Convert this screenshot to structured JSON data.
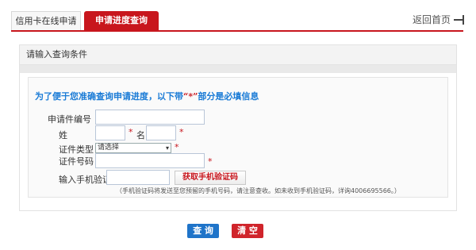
{
  "tabs": {
    "apply_label": "信用卡在线申请",
    "progress_label": "申请进度查询"
  },
  "back_home_label": "返回首页",
  "panel": {
    "title": "请输入查询条件"
  },
  "notice": {
    "prefix": "为了便于您准确查询申请进度，以下带",
    "star_mark": "“*”",
    "suffix": "部分是必填信息"
  },
  "form": {
    "app_no_label": "申请件编号",
    "app_no_value": "",
    "surname_label": "姓",
    "surname_value": "",
    "given_name_label": "名",
    "given_name_value": "",
    "id_type_label": "证件类型",
    "id_type_selected": "请选择",
    "id_no_label": "证件号码",
    "id_no_value": "",
    "sms_label": "输入手机验证码",
    "sms_value": "",
    "sms_button_label": "获取手机验证码",
    "required_mark": "*",
    "hint": "（手机验证码将发送至您预留的手机号码，请注意查收。如未收到手机验证码，详询4006695566。）"
  },
  "actions": {
    "query_label": "查 询",
    "clear_label": "清 空"
  },
  "colors": {
    "brand_red": "#c8161d",
    "link_blue": "#1a7bd6",
    "query_blue": "#1f74c9"
  }
}
